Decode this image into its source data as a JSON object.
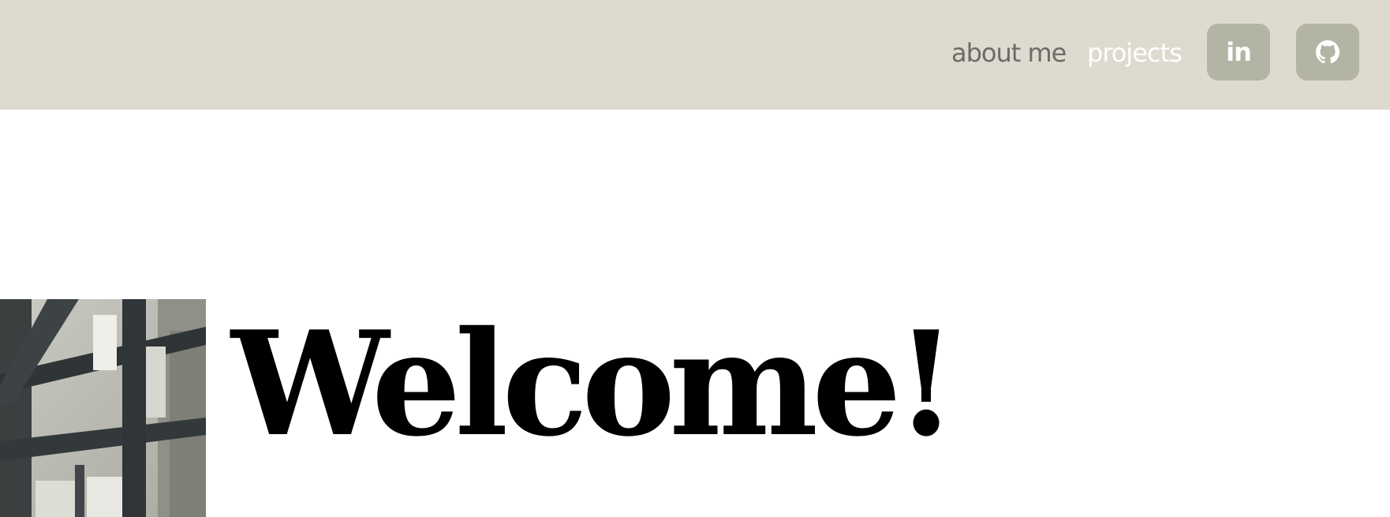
{
  "nav": {
    "about_label": "about me",
    "projects_label": "projects",
    "linkedin_label": "in",
    "linkedin_icon": "linkedin-icon",
    "github_icon": "github-icon"
  },
  "hero": {
    "title": "Welcome!",
    "photo": "profile-photo"
  },
  "colors": {
    "header_bg": "#dedacf",
    "icon_button_bg": "#b3b4a3",
    "nav_text": "#6d6b66",
    "nav_active_text": "#ffffff",
    "title_text": "#000000",
    "subtitle_text": "#a7a796"
  }
}
